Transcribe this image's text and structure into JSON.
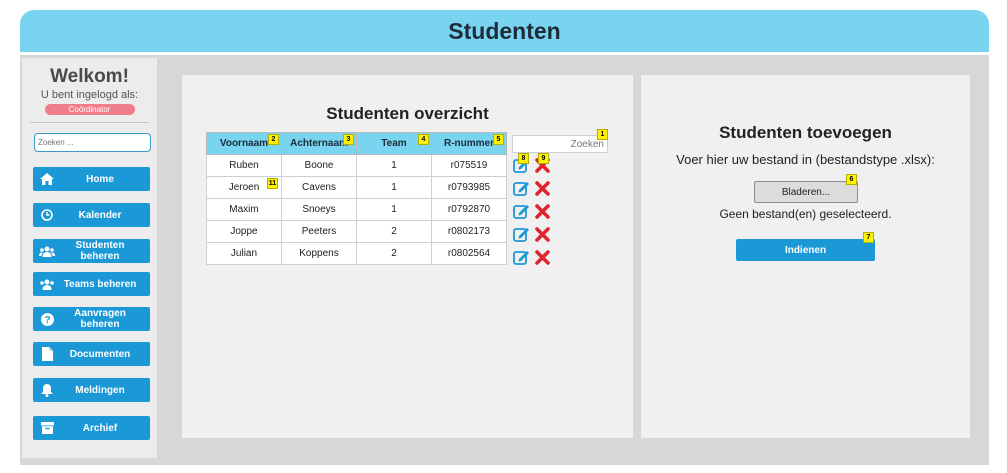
{
  "header": {
    "title": "Studenten"
  },
  "sidebar": {
    "welcome": "Welkom!",
    "logged_in_as": "U bent ingelogd als:",
    "role": "Coördinator",
    "search_placeholder": "Zoeken ...",
    "items": [
      {
        "label": "Home",
        "icon": "home-icon"
      },
      {
        "label": "Kalender",
        "icon": "clock-icon"
      },
      {
        "label": "Studenten beheren",
        "icon": "users-icon"
      },
      {
        "label": "Teams beheren",
        "icon": "users-icon"
      },
      {
        "label": "Aanvragen beheren",
        "icon": "question-icon"
      },
      {
        "label": "Documenten",
        "icon": "document-icon"
      },
      {
        "label": "Meldingen",
        "icon": "bell-icon"
      },
      {
        "label": "Archief",
        "icon": "archive-icon"
      }
    ]
  },
  "overview": {
    "title": "Studenten overzicht",
    "search_placeholder": "Zoeken",
    "columns": [
      "Voornaam",
      "Achternaam",
      "Team",
      "R-nummer"
    ],
    "column_badges": [
      "2",
      "3",
      "4",
      "5"
    ],
    "search_badge": "1",
    "edit_badge": "8",
    "delete_badge": "9",
    "row_badge": "11",
    "rows": [
      {
        "voornaam": "Ruben",
        "achternaam": "Boone",
        "team": "1",
        "rnummer": "r075519"
      },
      {
        "voornaam": "Jeroen",
        "achternaam": "Cavens",
        "team": "1",
        "rnummer": "r0793985"
      },
      {
        "voornaam": "Maxim",
        "achternaam": "Snoeys",
        "team": "1",
        "rnummer": "r0792870"
      },
      {
        "voornaam": "Joppe",
        "achternaam": "Peeters",
        "team": "2",
        "rnummer": "r0802173"
      },
      {
        "voornaam": "Julian",
        "achternaam": "Koppens",
        "team": "2",
        "rnummer": "r0802564"
      }
    ]
  },
  "upload": {
    "title": "Studenten toevoegen",
    "instruction": "Voer hier uw bestand in (bestandstype .xlsx):",
    "browse_label": "Bladeren...",
    "browse_badge": "6",
    "no_file": "Geen bestand(en) geselecteerd.",
    "submit_label": "Indienen",
    "submit_badge": "7"
  },
  "colors": {
    "header_bg": "#78d4ef",
    "nav_bg": "#1b99d6",
    "role_bg": "#f07d8a",
    "edit_icon": "#1b99d6",
    "delete_icon": "#e0242b",
    "badge_bg": "#fff200"
  }
}
